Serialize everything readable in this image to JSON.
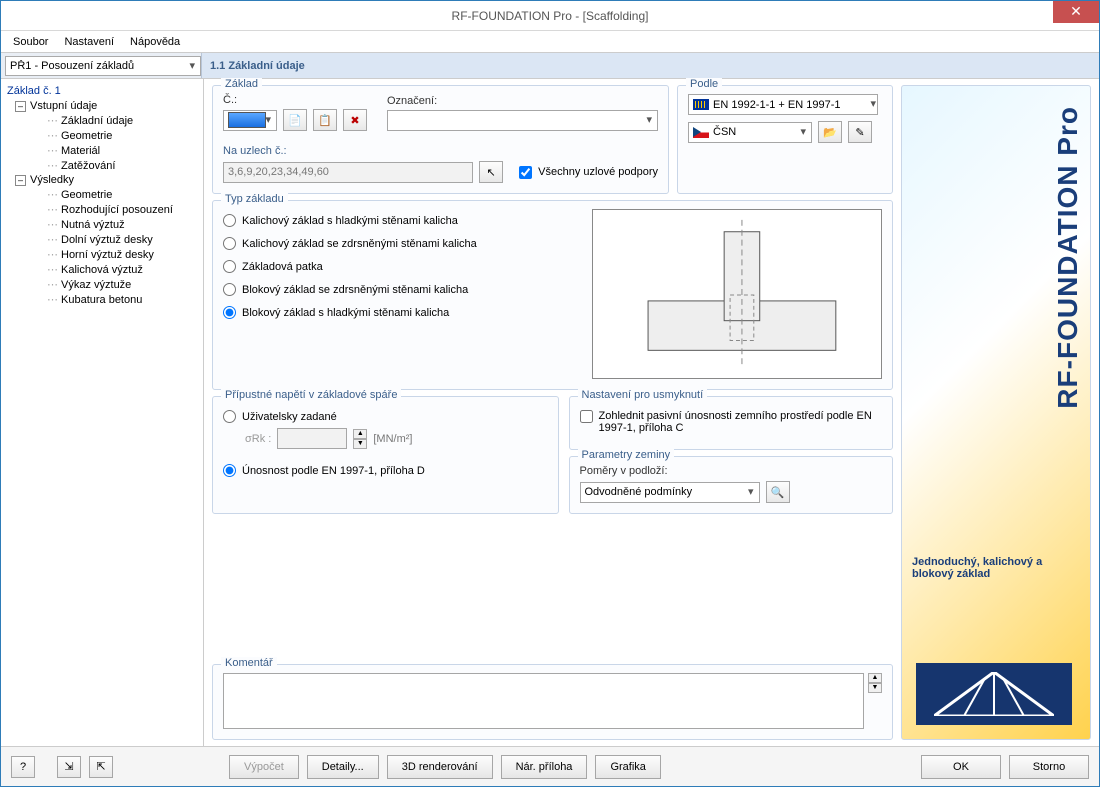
{
  "window": {
    "title": "RF-FOUNDATION Pro - [Scaffolding]"
  },
  "menu": {
    "file": "Soubor",
    "settings": "Nastavení",
    "help": "Nápověda"
  },
  "case_selector": "PŘ1 - Posouzení základů",
  "panel_title": "1.1 Základní údaje",
  "tree": {
    "root": "Základ č. 1",
    "input": "Vstupní údaje",
    "input_items": [
      "Základní údaje",
      "Geometrie",
      "Materiál",
      "Zatěžování"
    ],
    "results": "Výsledky",
    "results_items": [
      "Geometrie",
      "Rozhodující posouzení",
      "Nutná výztuž",
      "Dolní výztuž desky",
      "Horní výztuž desky",
      "Kalichová výztuž",
      "Výkaz výztuže",
      "Kubatura betonu"
    ]
  },
  "groups": {
    "zaklad": {
      "legend": "Základ",
      "no_label": "Č.:",
      "designation_label": "Označení:",
      "nodes_label": "Na uzlech č.:",
      "nodes_value": "3,6,9,20,23,34,49,60",
      "all_supports": "Všechny uzlové podpory"
    },
    "podle": {
      "legend": "Podle",
      "standard": "EN 1992-1-1 + EN 1997-1",
      "nat_annex": "ČSN"
    },
    "typ": {
      "legend": "Typ základu",
      "options": [
        "Kalichový základ s hladkými stěnami kalicha",
        "Kalichový základ se zdrsněnými stěnami kalicha",
        "Základová patka",
        "Blokový základ se zdrsněnými stěnami kalicha",
        "Blokový základ s hladkými stěnami kalicha"
      ],
      "selected_index": 4
    },
    "napeti": {
      "legend": "Přípustné napětí v základové spáře",
      "opt_user": "Uživatelsky zadané",
      "sigma_label": "σRk :",
      "unit": "[MN/m²]",
      "opt_en": "Únosnost podle EN 1997-1, příloha D",
      "selected": "en"
    },
    "usmyk": {
      "legend": "Nastavení pro usmyknutí",
      "check": "Zohlednit pasivní únosnosti zemního prostředí podle EN 1997-1, příloha C"
    },
    "zemina": {
      "legend": "Parametry zeminy",
      "ratio_label": "Poměry v podloží:",
      "ratio_value": "Odvodněné podmínky"
    },
    "comment": {
      "legend": "Komentář"
    }
  },
  "promo": {
    "vtext": "RF-FOUNDATION Pro",
    "tagline": "Jednoduchý, kalichový a blokový základ"
  },
  "buttons": {
    "calc": "Výpočet",
    "details": "Detaily...",
    "render": "3D renderování",
    "annex": "Nár. příloha",
    "graphics": "Grafika",
    "ok": "OK",
    "cancel": "Storno"
  }
}
